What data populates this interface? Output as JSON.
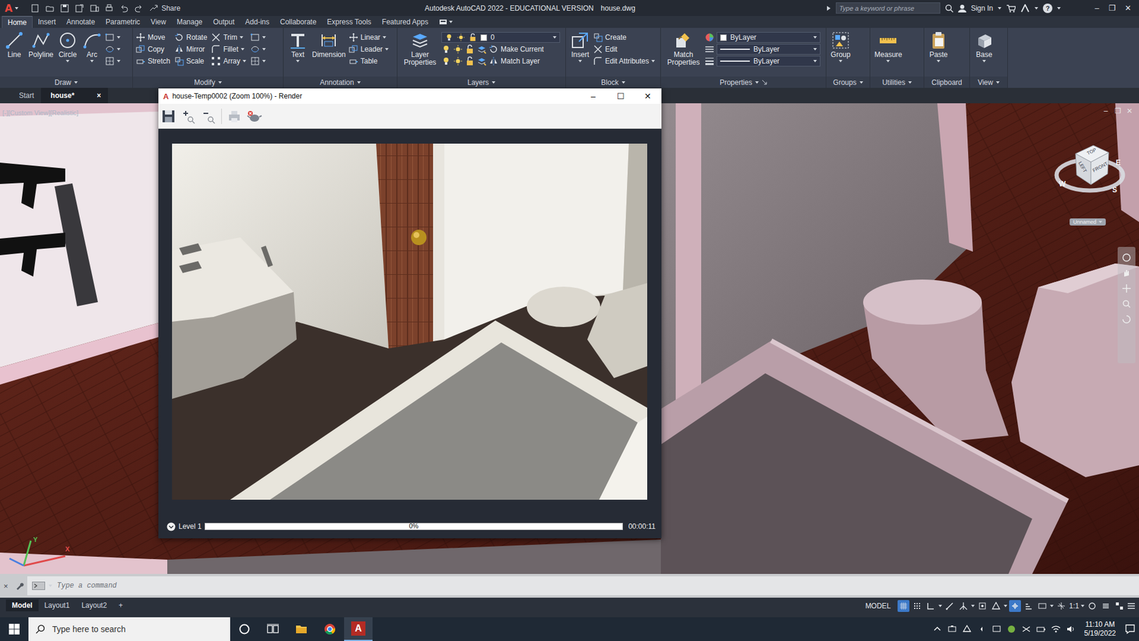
{
  "title_bar": {
    "logo": "A",
    "share": "Share",
    "title": "Autodesk AutoCAD 2022 - EDUCATIONAL VERSION",
    "file_name": "house.dwg",
    "search_placeholder": "Type a keyword or phrase",
    "sign_in": "Sign In",
    "help": "?",
    "controls": [
      "–",
      "❐",
      "✕"
    ]
  },
  "ribbon_tabs": [
    {
      "label": "Home",
      "selected": true
    },
    {
      "label": "Insert",
      "selected": false
    },
    {
      "label": "Annotate",
      "selected": false
    },
    {
      "label": "Parametric",
      "selected": false
    },
    {
      "label": "View",
      "selected": false
    },
    {
      "label": "Manage",
      "selected": false
    },
    {
      "label": "Output",
      "selected": false
    },
    {
      "label": "Add-ins",
      "selected": false
    },
    {
      "label": "Collaborate",
      "selected": false
    },
    {
      "label": "Express Tools",
      "selected": false
    },
    {
      "label": "Featured Apps",
      "selected": false
    }
  ],
  "ribbon_panels": [
    {
      "title": "Draw",
      "has_menu": true,
      "items": [
        {
          "kind": "large",
          "label": "Line",
          "has_menu": false
        },
        {
          "kind": "large",
          "label": "Polyline",
          "has_menu": false
        },
        {
          "kind": "large",
          "label": "Circle",
          "has_menu": true
        },
        {
          "kind": "large",
          "label": "Arc",
          "has_menu": true
        }
      ]
    },
    {
      "title": "Modify",
      "has_menu": true,
      "items": [
        {
          "kind": "column",
          "rows": [
            {
              "kind": "button",
              "label": "Move",
              "has_menu": false
            },
            {
              "kind": "button",
              "label": "Copy",
              "has_menu": false
            },
            {
              "kind": "button",
              "label": "Stretch",
              "has_menu": false
            }
          ]
        },
        {
          "kind": "column",
          "rows": [
            {
              "kind": "button",
              "label": "Rotate",
              "has_menu": false
            },
            {
              "kind": "button",
              "label": "Mirror",
              "has_menu": false
            },
            {
              "kind": "button",
              "label": "Scale",
              "has_menu": false
            }
          ]
        },
        {
          "kind": "column",
          "rows": [
            {
              "kind": "button",
              "label": "Trim",
              "has_menu": true
            },
            {
              "kind": "button",
              "label": "Fillet",
              "has_menu": true
            },
            {
              "kind": "button",
              "label": "Array",
              "has_menu": true
            }
          ]
        }
      ]
    },
    {
      "title": "Annotation",
      "has_menu": true,
      "items": [
        {
          "kind": "large",
          "label": "Text",
          "has_menu": true
        },
        {
          "kind": "large",
          "label": "Dimension",
          "has_menu": false
        },
        {
          "kind": "column",
          "rows": [
            {
              "kind": "button",
              "label": "Linear",
              "has_menu": true
            },
            {
              "kind": "button",
              "label": "Leader",
              "has_menu": true
            },
            {
              "kind": "button",
              "label": "Table",
              "has_menu": false
            }
          ]
        }
      ]
    },
    {
      "title": "Layers",
      "has_menu": true,
      "items": [
        {
          "kind": "large",
          "label": "Layer Properties",
          "has_menu": false
        },
        {
          "kind": "column",
          "rows": [
            {
              "kind": "dropdown-layer",
              "label": "0"
            },
            {
              "kind": "button",
              "label": "Make Current",
              "has_menu": false
            },
            {
              "kind": "button",
              "label": "Match Layer",
              "has_menu": false
            }
          ]
        }
      ]
    },
    {
      "title": "Block",
      "has_menu": true,
      "items": [
        {
          "kind": "large",
          "label": "Insert",
          "has_menu": true
        },
        {
          "kind": "column",
          "rows": [
            {
              "kind": "button",
              "label": "Create",
              "has_menu": false
            },
            {
              "kind": "button",
              "label": "Edit",
              "has_menu": false
            },
            {
              "kind": "button",
              "label": "Edit Attributes",
              "has_menu": true
            }
          ]
        }
      ]
    },
    {
      "title": "Properties",
      "has_menu": true,
      "items": [
        {
          "kind": "large",
          "label": "Match Properties",
          "has_menu": false
        },
        {
          "kind": "column",
          "rows": [
            {
              "kind": "dropdown-color",
              "label": "ByLayer"
            },
            {
              "kind": "dropdown-line",
              "label": "ByLayer"
            },
            {
              "kind": "dropdown-line",
              "label": "ByLayer"
            }
          ]
        }
      ]
    },
    {
      "title": "Groups",
      "has_menu": true,
      "items": [
        {
          "kind": "large",
          "label": "Group",
          "has_menu": true
        }
      ]
    },
    {
      "title": "Utilities",
      "has_menu": true,
      "items": [
        {
          "kind": "large",
          "label": "Measure",
          "has_menu": true
        }
      ]
    },
    {
      "title": "Clipboard",
      "has_menu": false,
      "items": [
        {
          "kind": "large",
          "label": "Paste",
          "has_menu": true
        }
      ]
    },
    {
      "title": "View",
      "has_menu": true,
      "items": [
        {
          "kind": "large",
          "label": "Base",
          "has_menu": true
        }
      ]
    }
  ],
  "file_tabs": [
    {
      "label": "Start",
      "selected": false
    },
    {
      "label": "house*",
      "selected": true,
      "close": "×"
    }
  ],
  "viewport": {
    "label": "[-][Custom View][Realistic]",
    "controls": [
      "–",
      "❐",
      "✕"
    ],
    "viewcube": {
      "top": "TOP",
      "left": "LEFT",
      "front": "FRONT",
      "west": "W",
      "east": "E",
      "south": "S",
      "ucs": "Unnamed"
    },
    "axes": {
      "x": "X",
      "y": "Y"
    }
  },
  "render_window": {
    "logo": "A",
    "title": "house-Temp0002 (Zoom 100%) - Render",
    "controls": [
      "–",
      "☐",
      "✕"
    ],
    "level_label": "Level 1",
    "level": 0,
    "percent": "0%",
    "elapsed": "00:00:11"
  },
  "command_line": {
    "close": "×",
    "placeholder": "Type a command"
  },
  "layout_tabs": [
    {
      "label": "Model",
      "selected": true
    },
    {
      "label": "Layout1",
      "selected": false
    },
    {
      "label": "Layout2",
      "selected": false
    }
  ],
  "add_layout": "+",
  "status_bar": {
    "model": "MODEL",
    "scale": "1:1",
    "toggles": [
      {
        "on": true
      },
      {
        "on": false
      },
      {
        "on": false
      },
      {
        "on": false
      },
      {
        "on": false
      },
      {
        "on": false
      },
      {
        "on": false
      },
      {
        "on": true
      },
      {
        "on": false
      },
      {
        "on": false
      },
      {
        "on": false
      },
      {
        "on": false
      },
      {
        "on": false
      },
      {
        "on": false
      }
    ]
  },
  "taskbar": {
    "search_placeholder": "Type here to search",
    "apps": [
      {
        "kind": "cortana",
        "selected": false
      },
      {
        "kind": "taskview",
        "selected": false
      },
      {
        "kind": "explorer",
        "selected": false
      },
      {
        "kind": "chrome",
        "selected": false
      },
      {
        "kind": "autocad",
        "selected": true,
        "label": "A"
      }
    ],
    "time": "11:10 AM",
    "date": "5/19/2022"
  }
}
